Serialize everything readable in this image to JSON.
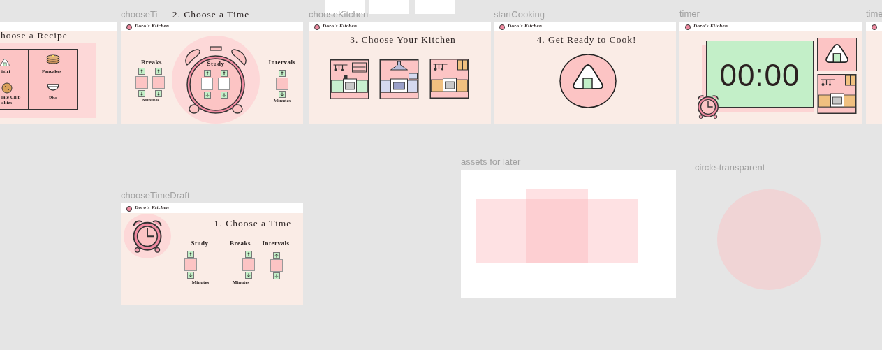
{
  "frames": [
    {
      "kind": "recipe",
      "title": "hoose a Recipe",
      "items": [
        {
          "kind": "onigiri",
          "lines": [
            "igiri"
          ]
        },
        {
          "kind": "pancakes",
          "lines": [
            "Pancakes"
          ]
        },
        {
          "kind": "cookie",
          "lines": [
            "late Chip",
            "okies"
          ]
        },
        {
          "kind": "pho",
          "lines": [
            "Pho"
          ]
        }
      ]
    },
    {
      "kind": "choose_time",
      "label": "chooseTi",
      "brand": "Doro's Kitchen",
      "title": "2. Choose a Time",
      "groups": [
        {
          "label": "Breaks",
          "unit": "Minutes"
        },
        {
          "label": "Study"
        },
        {
          "label": "Intervals",
          "unit": "Minutes"
        }
      ]
    },
    {
      "kind": "kitchen",
      "label": "chooseKitchen",
      "brand": "Doro's Kitchen",
      "title": "3. Choose Your Kitchen"
    },
    {
      "kind": "ready",
      "label": "startCooking",
      "brand": "Doro's Kitchen",
      "title": "4. Get Ready to Cook!"
    },
    {
      "kind": "timer",
      "label": "timer",
      "brand": "Doro's Kitchen",
      "time": "00:00"
    },
    {
      "kind": "stub",
      "label": "time"
    },
    {
      "kind": "draft",
      "label": "chooseTimeDraft",
      "brand": "Doro's Kitchen",
      "title": "1. Choose a Time",
      "groups": [
        {
          "label": "Study",
          "unit": "Minutes"
        },
        {
          "label": "Breaks",
          "unit": "Minutes"
        },
        {
          "label": "Intervals"
        }
      ]
    },
    {
      "kind": "assets",
      "label": "assets for later"
    },
    {
      "kind": "circle",
      "label": "circle-transparent"
    }
  ]
}
